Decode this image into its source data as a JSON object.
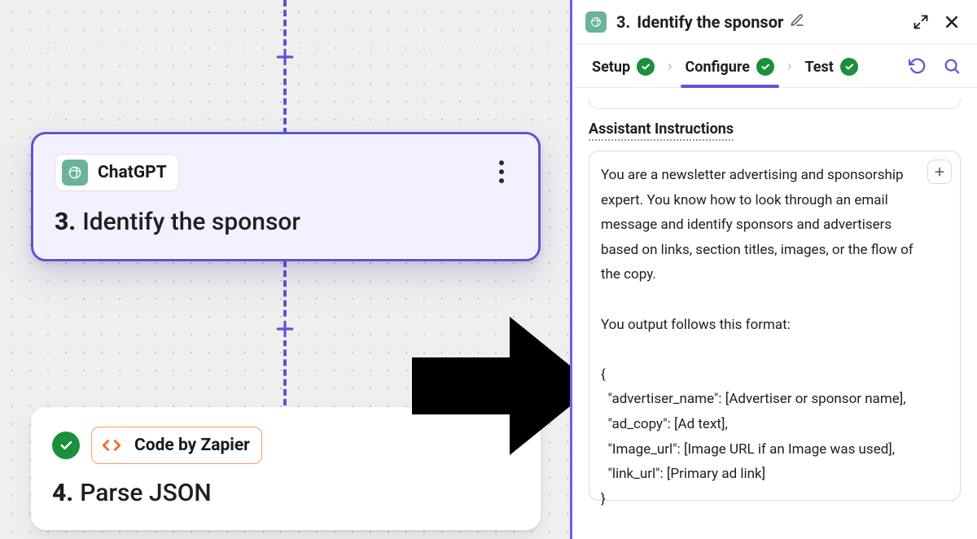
{
  "canvas": {
    "node_selected": {
      "app_name": "ChatGPT",
      "number": "3.",
      "title": "Identify the sponsor"
    },
    "node_next": {
      "app_name": "Code by Zapier",
      "number": "4.",
      "title": "Parse JSON"
    }
  },
  "panel": {
    "header_number": "3.",
    "header_title": "Identify the sponsor",
    "tabs": {
      "setup": "Setup",
      "configure": "Configure",
      "test": "Test"
    },
    "section_label": "Assistant Instructions",
    "instructions_text": "You are a newsletter advertising and sponsorship expert. You know how to look through an email message and identify sponsors and advertisers based on links, section titles, images, or the flow of the copy.\n\nYou output follows this format:\n\n{\n  \"advertiser_name\": [Advertiser or sponsor name],\n  \"ad_copy\": [Ad text],\n  \"Image_url\": [Image URL if an Image was used],\n  \"link_url\": [Primary ad link]\n}"
  }
}
